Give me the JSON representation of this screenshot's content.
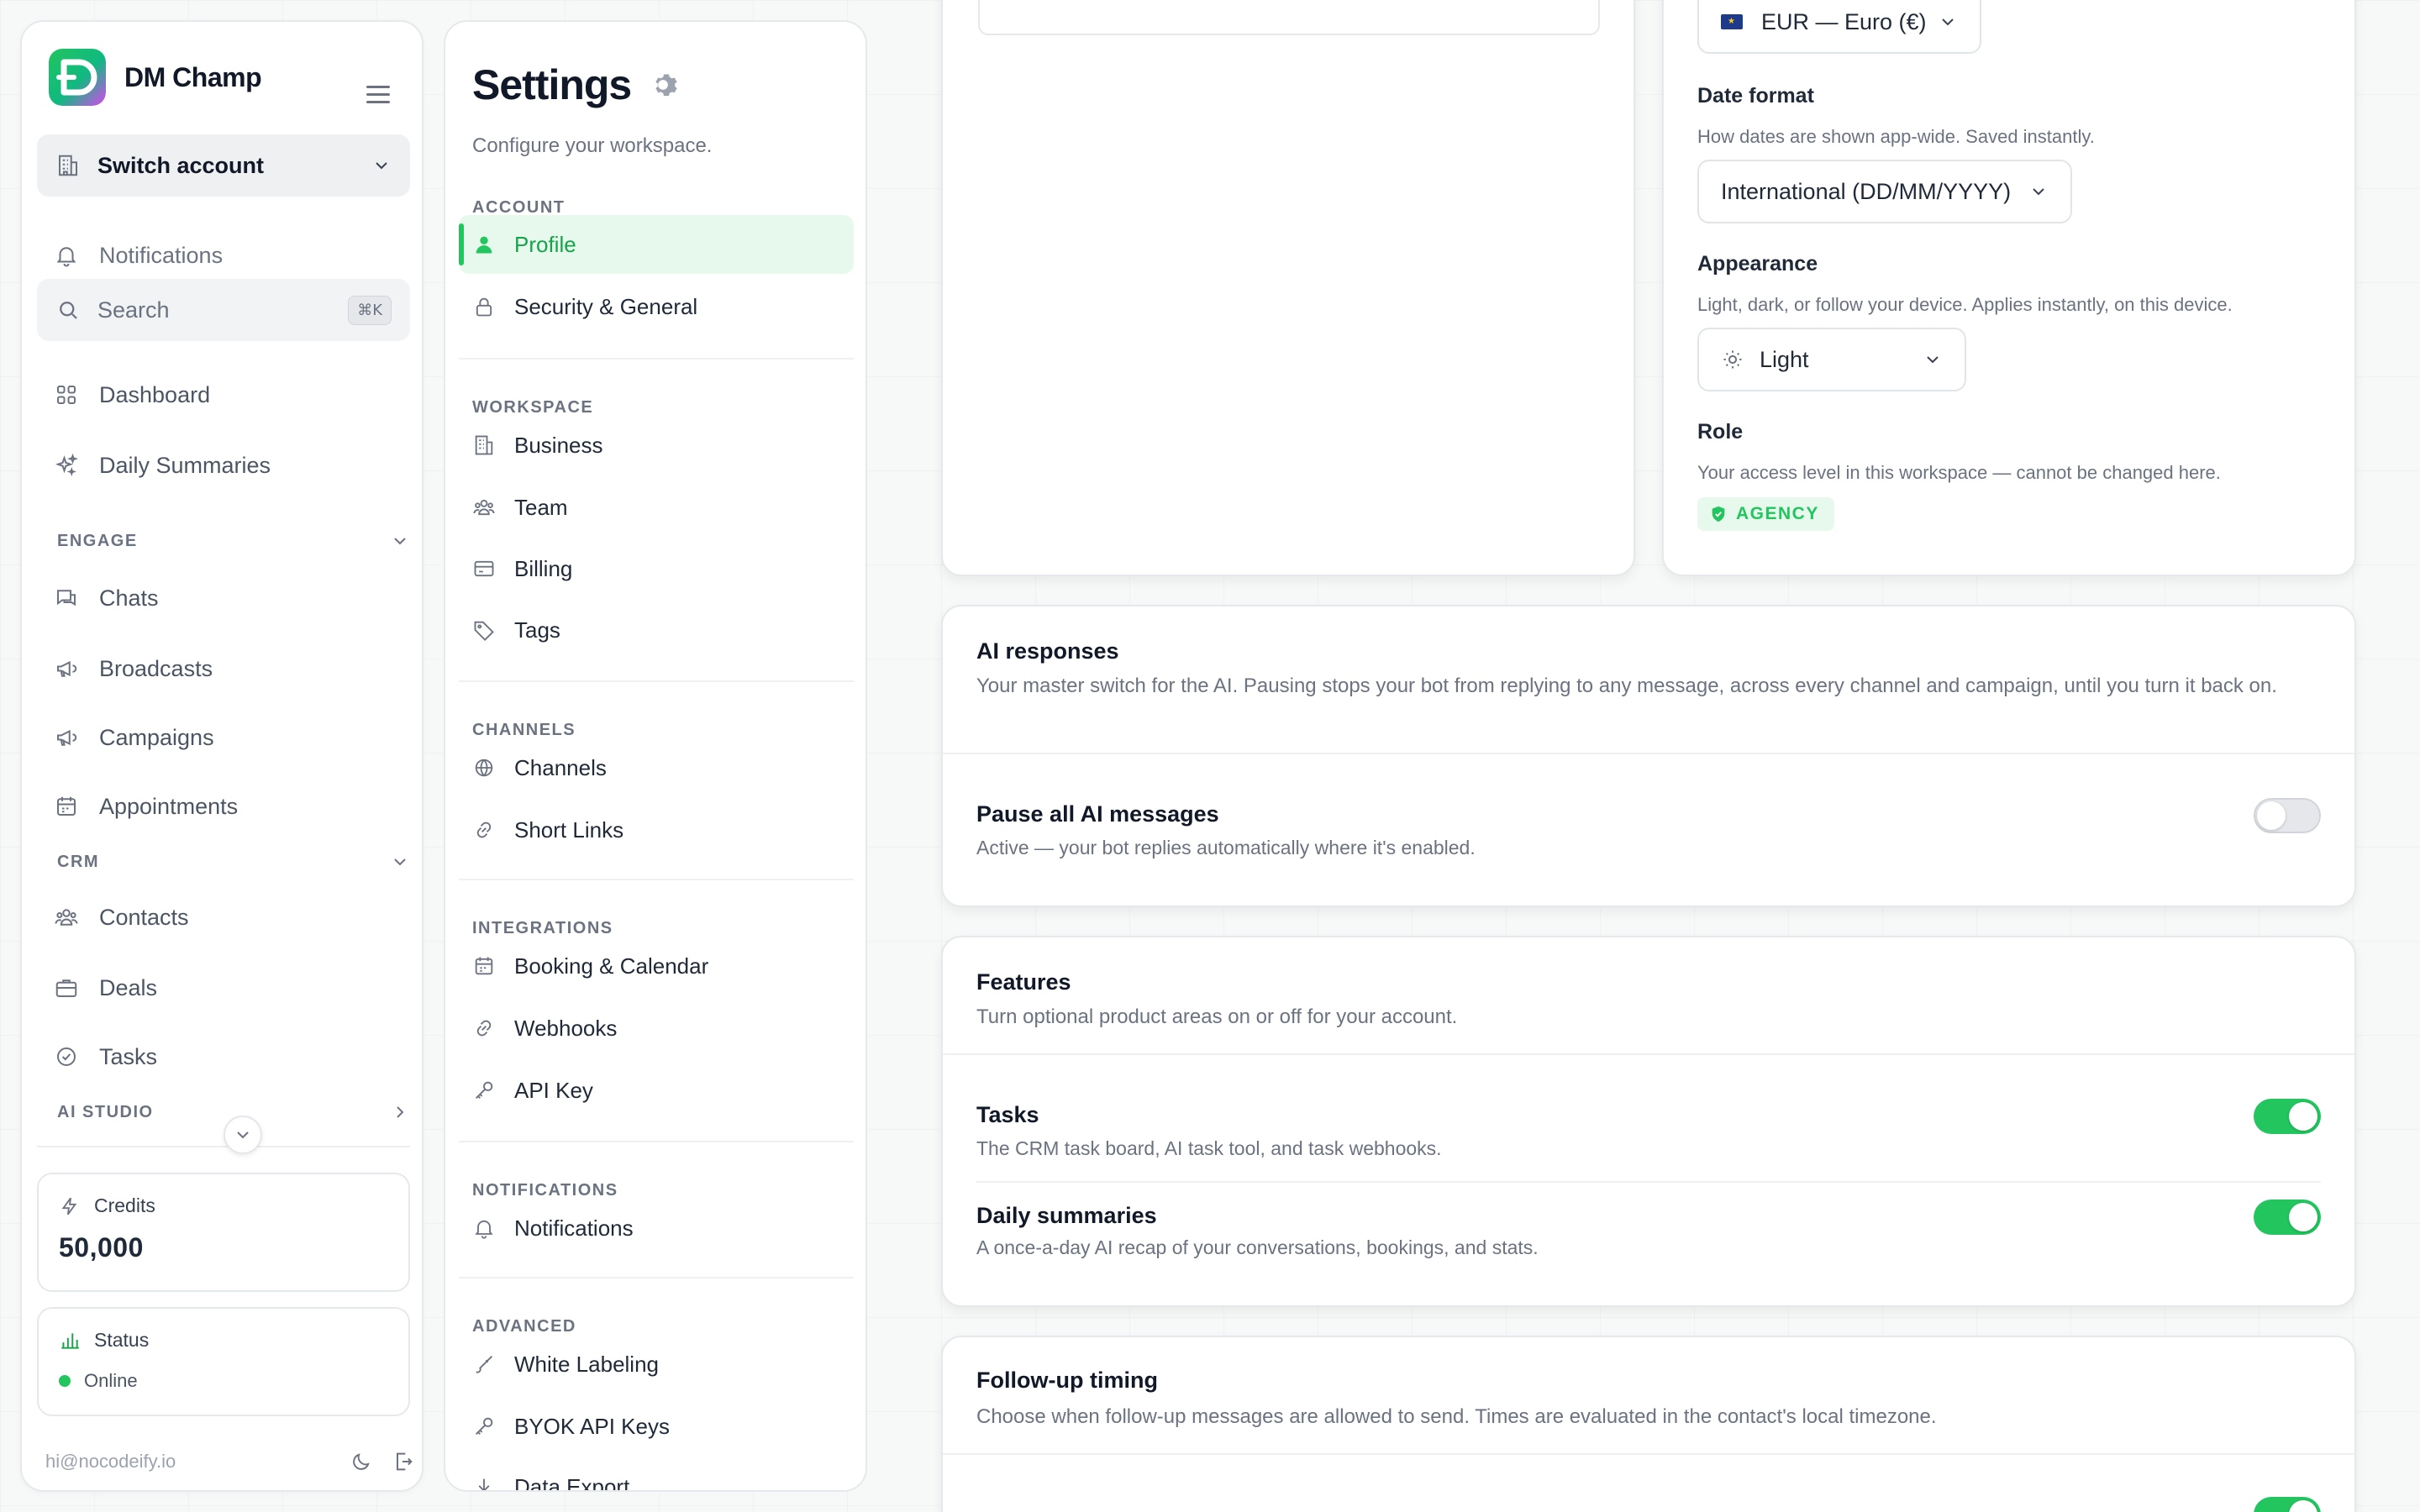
{
  "brand": {
    "name": "DM Champ"
  },
  "sidebar": {
    "switch_account": "Switch account",
    "notifications": "Notifications",
    "search": {
      "label": "Search",
      "shortcut": "⌘K"
    },
    "dashboard": "Dashboard",
    "daily_summaries": "Daily Summaries",
    "engage": {
      "title": "ENGAGE",
      "items": [
        "Chats",
        "Broadcasts",
        "Campaigns",
        "Appointments"
      ]
    },
    "crm": {
      "title": "CRM",
      "items": [
        "Contacts",
        "Deals",
        "Tasks"
      ]
    },
    "ai_studio": {
      "title": "AI STUDIO"
    },
    "credits": {
      "label": "Credits",
      "value": "50,000"
    },
    "status": {
      "label": "Status",
      "value": "Online"
    },
    "email": "hi@nocodeify.io"
  },
  "settings_nav": {
    "title": "Settings",
    "subtitle": "Configure your workspace.",
    "sections": {
      "account": {
        "title": "ACCOUNT",
        "items": [
          "Profile",
          "Security & General"
        ]
      },
      "workspace": {
        "title": "WORKSPACE",
        "items": [
          "Business",
          "Team",
          "Billing",
          "Tags"
        ]
      },
      "channels": {
        "title": "CHANNELS",
        "items": [
          "Channels",
          "Short Links"
        ]
      },
      "integrations": {
        "title": "INTEGRATIONS",
        "items": [
          "Booking & Calendar",
          "Webhooks",
          "API Key"
        ]
      },
      "notifications": {
        "title": "NOTIFICATIONS",
        "items": [
          "Notifications"
        ]
      },
      "advanced": {
        "title": "ADVANCED",
        "items": [
          "White Labeling",
          "BYOK API Keys",
          "Data Export"
        ]
      }
    }
  },
  "preferences": {
    "currency": {
      "value": "EUR — Euro (€)"
    },
    "date_format": {
      "title": "Date format",
      "desc": "How dates are shown app-wide. Saved instantly.",
      "value": "International (DD/MM/YYYY)"
    },
    "appearance": {
      "title": "Appearance",
      "desc": "Light, dark, or follow your device. Applies instantly, on this device.",
      "value": "Light"
    },
    "role": {
      "title": "Role",
      "desc": "Your access level in this workspace — cannot be changed here.",
      "value": "AGENCY"
    }
  },
  "ai_responses": {
    "title": "AI responses",
    "desc": "Your master switch for the AI. Pausing stops your bot from replying to any message, across every channel and campaign, until you turn it back on.",
    "pause": {
      "title": "Pause all AI messages",
      "desc": "Active — your bot replies automatically where it's enabled.",
      "enabled": false
    }
  },
  "features": {
    "title": "Features",
    "desc": "Turn optional product areas on or off for your account.",
    "tasks": {
      "title": "Tasks",
      "desc": "The CRM task board, AI task tool, and task webhooks.",
      "enabled": true
    },
    "daily_summaries": {
      "title": "Daily summaries",
      "desc": "A once-a-day AI recap of your conversations, bookings, and stats.",
      "enabled": true
    }
  },
  "followup": {
    "title": "Follow-up timing",
    "desc": "Choose when follow-up messages are allowed to send. Times are evaluated in the contact's local timezone."
  },
  "colors": {
    "accent": "#22c55e",
    "accent_bg": "#e7f8ec"
  }
}
